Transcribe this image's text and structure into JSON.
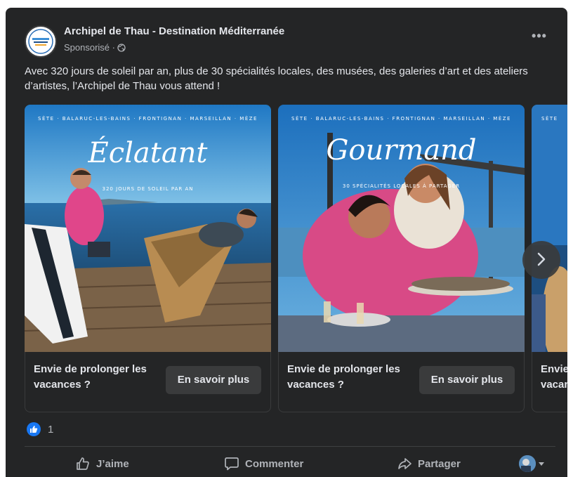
{
  "post": {
    "page_name": "Archipel de Thau - Destination Méditerranée",
    "sponsored": "Sponsorisé ·",
    "text": "Avec 320 jours de soleil par an, plus de 30 spécialités locales, des musées, des galeries d’art et des ateliers d’artistes, l’Archipel de Thau vous attend !",
    "more_icon": "more-horizontal-icon",
    "privacy_icon": "globe-icon"
  },
  "carousel": {
    "slides": [
      {
        "places": "SÈTE · BALARUC-LES-BAINS · FRONTIGNAN · MARSEILLAN · MÈZE",
        "title": "Éclatant",
        "subtitle": "320 JOURS DE SOLEIL PAR AN",
        "caption": "Envie de prolonger les vacances ?",
        "button": "En savoir plus"
      },
      {
        "places": "SÈTE · BALARUC-LES-BAINS · FRONTIGNAN · MARSEILLAN · MÈZE",
        "title": "Gourmand",
        "subtitle": "30 SPÉCIALITÉS LOCALES À PARTAGER",
        "caption": "Envie de prolonger les vacances ?",
        "button": "En savoir plus"
      },
      {
        "places": "SÈTE",
        "caption": "Envie de prolonger les vacances ?"
      }
    ],
    "next_icon": "chevron-right-icon"
  },
  "reactions": {
    "count": "1",
    "icon": "like-reaction-icon"
  },
  "actions": {
    "like": "J’aime",
    "comment": "Commenter",
    "share": "Partager"
  },
  "colors": {
    "card_bg": "#242526",
    "button_bg": "#3a3b3c",
    "text_primary": "#e4e6eb",
    "text_secondary": "#b0b3b8",
    "like_blue": "#1877f2"
  }
}
